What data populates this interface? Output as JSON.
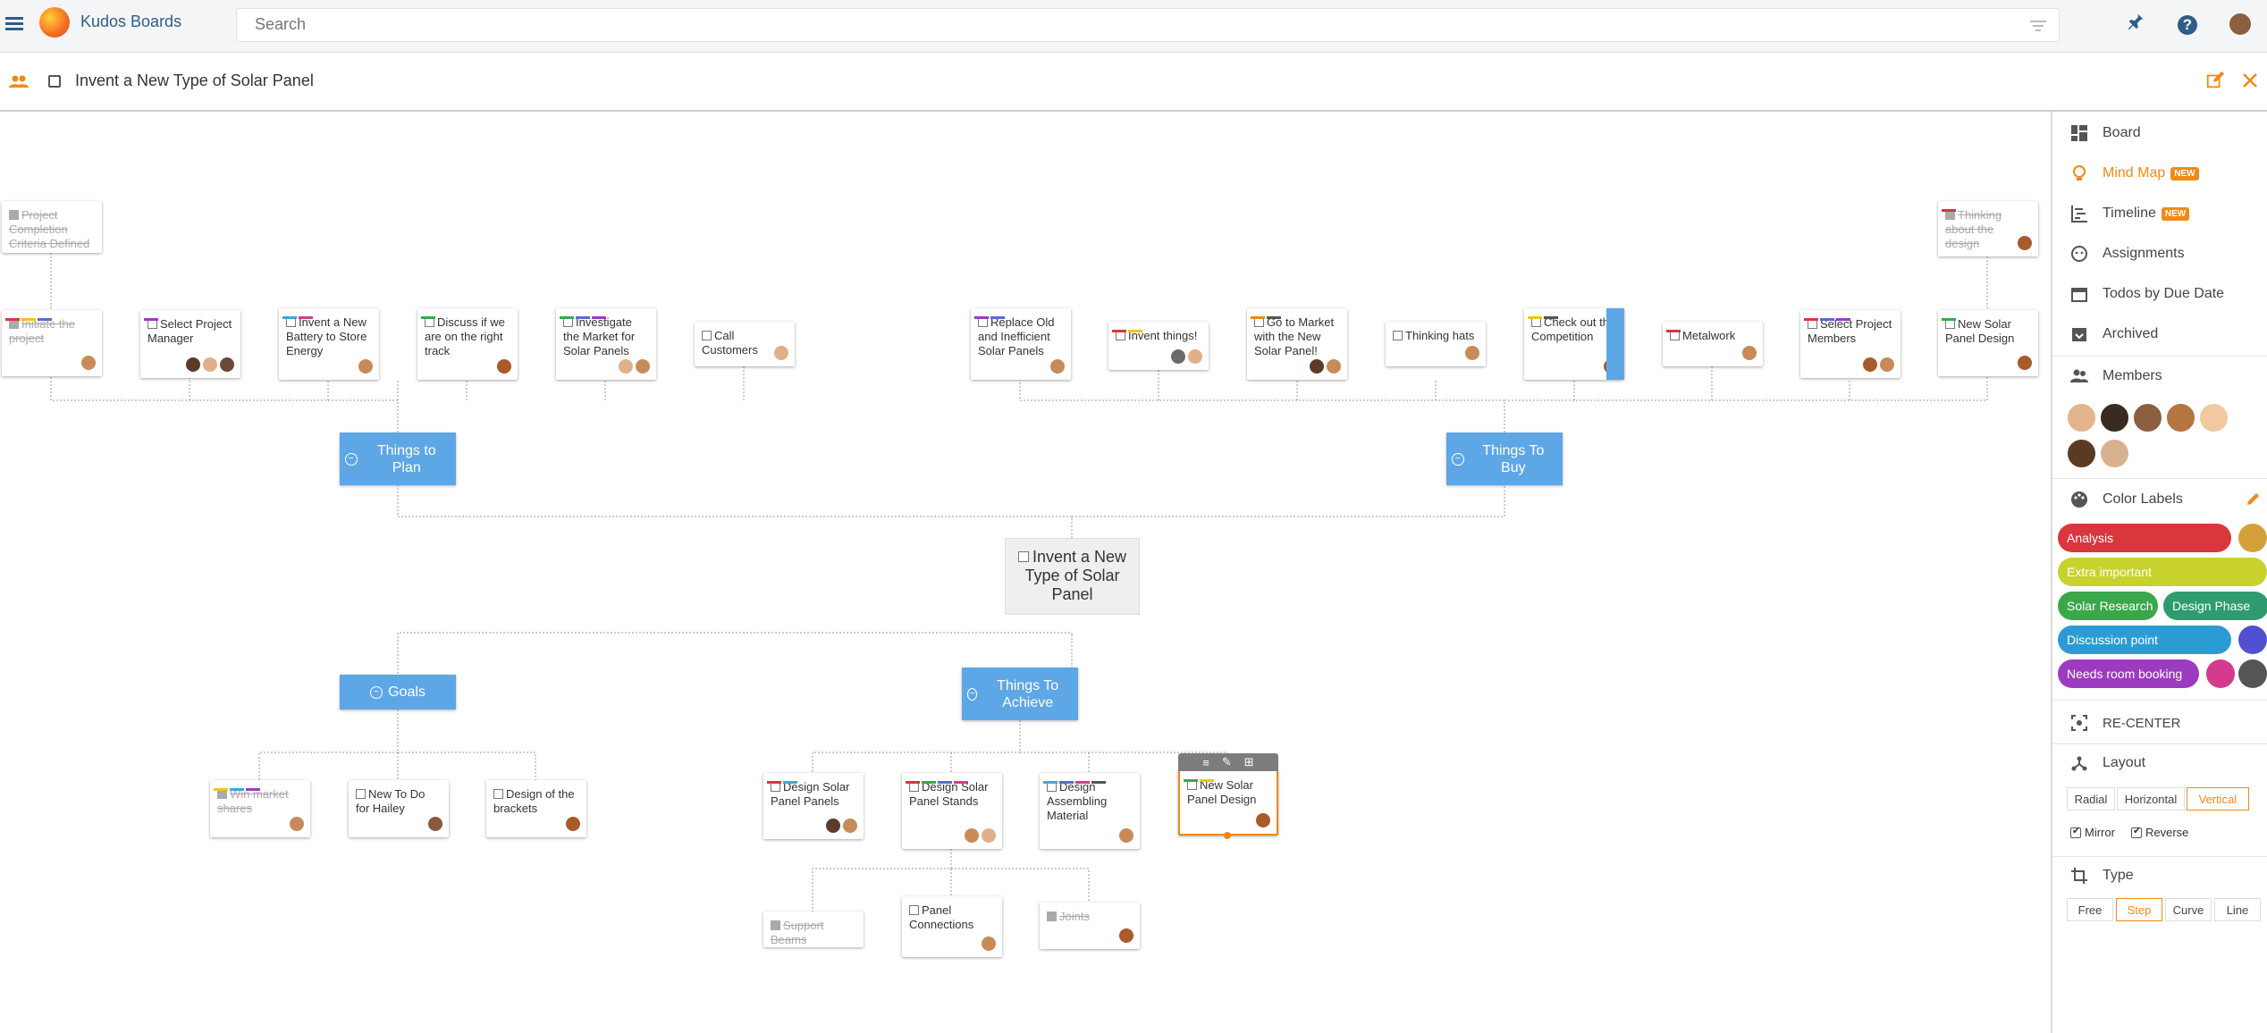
{
  "app": {
    "brand": "Kudos Boards",
    "search_placeholder": "Search"
  },
  "board": {
    "title": "Invent a New Type of Solar Panel"
  },
  "mindmap": {
    "root": {
      "title": "Invent a New Type of Solar Panel"
    },
    "hubs": [
      {
        "title": "Things to Plan"
      },
      {
        "title": "Things To Buy"
      },
      {
        "title": "Goals"
      },
      {
        "title": "Things To Achieve"
      }
    ],
    "cards": [
      {
        "title": "Project Completion Criteria Defined",
        "done": true,
        "labels": [],
        "avatars": []
      },
      {
        "title": "Initiate the project",
        "done": true,
        "labels": [
          "#d9363e",
          "#f0c419",
          "#5b6ad0"
        ],
        "avatars": [
          "#c98a5a"
        ]
      },
      {
        "title": "Select Project Manager",
        "done": false,
        "labels": [
          "#9c3bbf"
        ],
        "avatars": [
          "#5b3b2a",
          "#e0b08a",
          "#6b4a3a"
        ]
      },
      {
        "title": "Invent a New Battery to Store Energy",
        "done": false,
        "labels": [
          "#3ea7d9",
          "#d43a8d"
        ],
        "avatars": [
          "#c98a5a"
        ]
      },
      {
        "title": "Discuss if we are on the right track",
        "done": false,
        "labels": [
          "#3aa84a"
        ],
        "avatars": [
          "#a85a2a"
        ]
      },
      {
        "title": "Investigate the Market for Solar Panels",
        "done": false,
        "labels": [
          "#3aa84a",
          "#5b6ad0",
          "#9c3bbf"
        ],
        "avatars": [
          "#e0b08a",
          "#c98a5a"
        ]
      },
      {
        "title": "Call Customers",
        "done": false,
        "labels": [],
        "avatars": [
          "#e0b08a"
        ]
      },
      {
        "title": "Replace Old and Inefficient Solar Panels",
        "done": false,
        "labels": [
          "#9c3bbf",
          "#5b6ad0"
        ],
        "avatars": [
          "#c98a5a"
        ]
      },
      {
        "title": "Invent things!",
        "done": false,
        "labels": [
          "#d9363e",
          "#f0c419"
        ],
        "avatars": [
          "#6b6b6b",
          "#e0b08a"
        ]
      },
      {
        "title": "Go to Market with the New Solar Panel!",
        "done": false,
        "labels": [
          "#f08a16",
          "#555"
        ],
        "avatars": [
          "#5b3b2a",
          "#c98a5a"
        ]
      },
      {
        "title": "Thinking hats",
        "done": false,
        "labels": [],
        "avatars": [
          "#c98a5a"
        ]
      },
      {
        "title": "Check out the Competition",
        "done": false,
        "labels": [
          "#f0c419",
          "#555"
        ],
        "avatars": [
          "#a85a2a"
        ]
      },
      {
        "title": "Metalwork",
        "done": false,
        "labels": [
          "#d9363e"
        ],
        "avatars": [
          "#c98a5a"
        ]
      },
      {
        "title": "Select Project Members",
        "done": false,
        "labels": [
          "#d9363e",
          "#5b6ad0",
          "#9c3bbf"
        ],
        "avatars": [
          "#a85a2a",
          "#c98a5a"
        ]
      },
      {
        "title": "Thinking about the design",
        "done": true,
        "labels": [
          "#d9363e"
        ],
        "avatars": [
          "#a85a2a"
        ]
      },
      {
        "title": "New Solar Panel Design",
        "done": false,
        "labels": [
          "#3aa84a"
        ],
        "avatars": [
          "#a85a2a"
        ]
      },
      {
        "title": "Win market shares",
        "done": true,
        "labels": [
          "#f0c419",
          "#3ea7d9",
          "#9c3bbf"
        ],
        "avatars": [
          "#c98a5a"
        ]
      },
      {
        "title": "New To Do for Hailey",
        "done": false,
        "labels": [],
        "avatars": [
          "#8a5a3a"
        ]
      },
      {
        "title": "Design of the brackets",
        "done": false,
        "labels": [],
        "avatars": [
          "#a85a2a"
        ]
      },
      {
        "title": "Design Solar Panel Panels",
        "done": false,
        "labels": [
          "#d9363e",
          "#3ea7d9"
        ],
        "avatars": [
          "#5b3b2a",
          "#c98a5a"
        ]
      },
      {
        "title": "Design Solar Panel Stands",
        "done": false,
        "labels": [
          "#d9363e",
          "#3aa84a",
          "#5b6ad0",
          "#d43a8d"
        ],
        "avatars": [
          "#c98a5a",
          "#e0b08a"
        ]
      },
      {
        "title": "Design Assembling Material",
        "done": false,
        "labels": [
          "#3ea7d9",
          "#5b6ad0",
          "#d43a8d",
          "#555"
        ],
        "avatars": [
          "#c98a5a"
        ]
      },
      {
        "title": "New Solar Panel Design",
        "done": false,
        "labels": [
          "#3aa84a",
          "#f0c419"
        ],
        "avatars": [
          "#a85a2a"
        ]
      },
      {
        "title": "Support Beams",
        "done": true,
        "labels": [],
        "avatars": []
      },
      {
        "title": "Panel Connections",
        "done": false,
        "labels": [],
        "avatars": [
          "#c98a5a"
        ]
      },
      {
        "title": "Joints",
        "done": true,
        "labels": [],
        "avatars": [
          "#a85a2a"
        ]
      }
    ]
  },
  "sidebar": {
    "views": [
      {
        "label": "Board",
        "badge": "",
        "icon": "board-icon"
      },
      {
        "label": "Mind Map",
        "badge": "NEW",
        "icon": "lightbulb-icon"
      },
      {
        "label": "Timeline",
        "badge": "NEW",
        "icon": "timeline-icon"
      },
      {
        "label": "Assignments",
        "badge": "",
        "icon": "assignments-icon"
      },
      {
        "label": "Todos by Due Date",
        "badge": "",
        "icon": "calendar-icon"
      },
      {
        "label": "Archived",
        "badge": "",
        "icon": "archive-icon"
      }
    ],
    "members_label": "Members",
    "members": [
      "#e3b48d",
      "#3b2a22",
      "#8a6040",
      "#b57540",
      "#f1c9a0",
      "#5a3a22",
      "#d8b190"
    ],
    "color_labels_title": "Color Labels",
    "color_labels": [
      {
        "name": "Analysis",
        "color": "#d9363e"
      },
      {
        "name": "",
        "color": "#d4a03a"
      },
      {
        "name": "Extra important",
        "color": "#c8d22e"
      },
      {
        "name": "Solar Research",
        "color": "#3aa84a"
      },
      {
        "name": "Design Phase",
        "color": "#2e9c6e"
      },
      {
        "name": "Discussion point",
        "color": "#2b9cd3"
      },
      {
        "name": "",
        "color": "#5050d0"
      },
      {
        "name": "Needs room booking",
        "color": "#9c3bbf"
      },
      {
        "name": "",
        "color": "#d43a8d"
      },
      {
        "name": "",
        "color": "#555555"
      }
    ],
    "recenter": "RE-CENTER",
    "layout_title": "Layout",
    "layout_options": [
      "Radial",
      "Horizontal",
      "Vertical"
    ],
    "layout_selected": "Vertical",
    "mirror": "Mirror",
    "reverse": "Reverse",
    "type_title": "Type",
    "type_options": [
      "Free",
      "Step",
      "Curve",
      "Line"
    ],
    "type_selected": "Step"
  },
  "colors": {
    "accent": "#f08a16",
    "brand": "#2f5d86",
    "hub": "#5ea7e6"
  }
}
